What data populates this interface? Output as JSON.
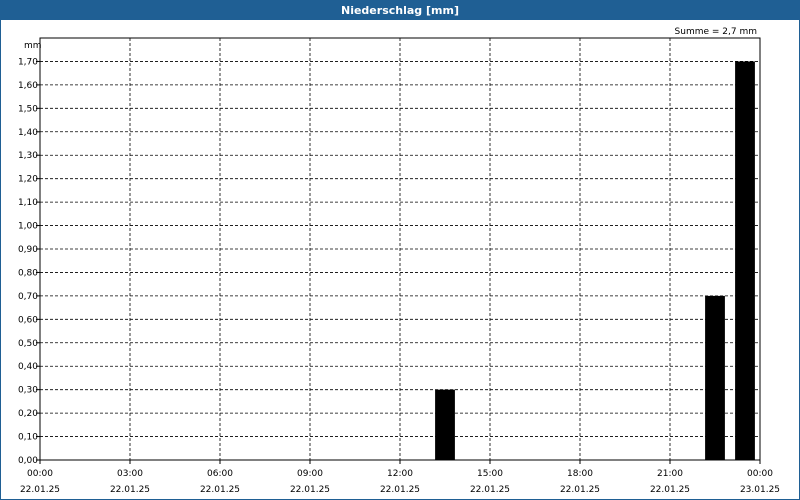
{
  "window": {
    "title": "Niederschlag [mm]"
  },
  "chart_data": {
    "type": "bar",
    "title": "Niederschlag [mm]",
    "annotation": "Summe = 2,7 mm",
    "ylabel": "mm",
    "ylim": [
      0,
      1.8
    ],
    "yticks": [
      "0,00",
      "0,10",
      "0,20",
      "0,30",
      "0,40",
      "0,50",
      "0,60",
      "0,70",
      "0,80",
      "0,90",
      "1,00",
      "1,10",
      "1,20",
      "1,30",
      "1,40",
      "1,50",
      "1,60",
      "1,70"
    ],
    "xlim_hours": [
      0,
      24
    ],
    "xticks": [
      {
        "time": "00:00",
        "date": "22.01.25"
      },
      {
        "time": "03:00",
        "date": "22.01.25"
      },
      {
        "time": "06:00",
        "date": "22.01.25"
      },
      {
        "time": "09:00",
        "date": "22.01.25"
      },
      {
        "time": "12:00",
        "date": "22.01.25"
      },
      {
        "time": "15:00",
        "date": "22.01.25"
      },
      {
        "time": "18:00",
        "date": "22.01.25"
      },
      {
        "time": "21:00",
        "date": "22.01.25"
      },
      {
        "time": "00:00",
        "date": "23.01.25"
      }
    ],
    "bar_width_hours": 0.66,
    "bars": [
      {
        "start": "22.01.25 13:00",
        "end": "22.01.25 14:00",
        "value": 0.3
      },
      {
        "start": "22.01.25 22:00",
        "end": "22.01.25 23:00",
        "value": 0.7
      },
      {
        "start": "22.01.25 23:00",
        "end": "23.01.25 00:00",
        "value": 1.7
      }
    ],
    "grid": true,
    "bar_color": "#000000"
  }
}
